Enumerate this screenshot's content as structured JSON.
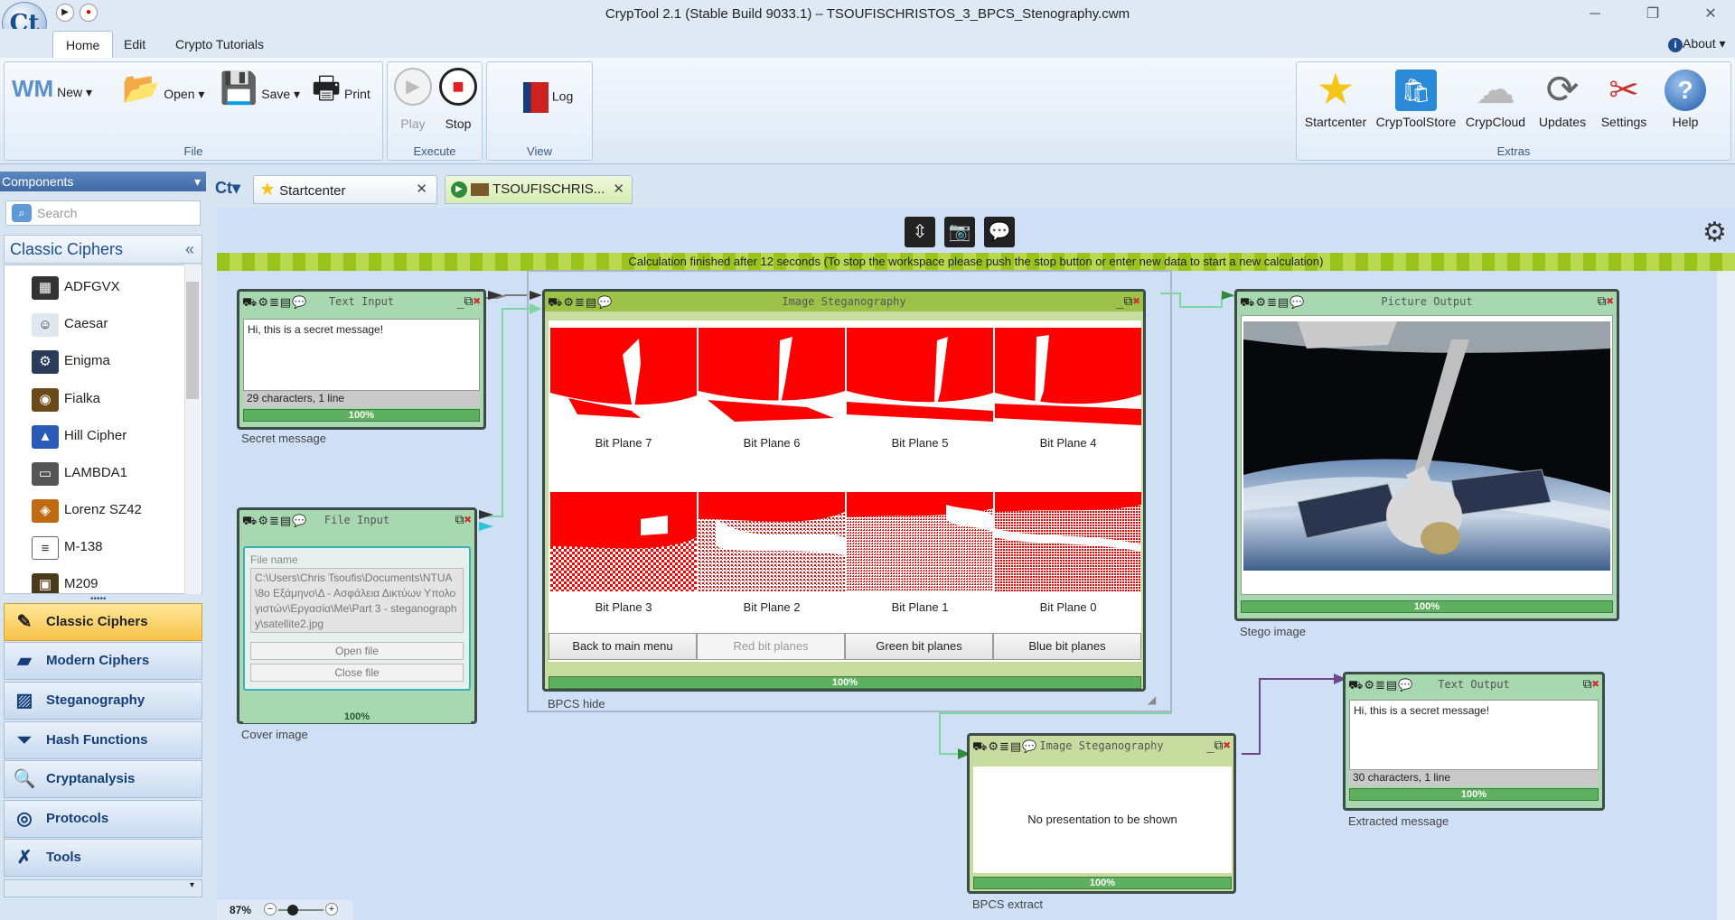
{
  "window": {
    "title": "CrypTool 2.1 (Stable Build 9033.1) – TSOUFISCHRISTOS_3_BPCS_Stenography.cwm"
  },
  "ribbon_tabs": [
    "Home",
    "Edit",
    "Crypto Tutorials"
  ],
  "about_label": "About",
  "ribbon": {
    "file": {
      "label": "File",
      "new": "New",
      "open": "Open",
      "save": "Save",
      "print": "Print"
    },
    "execute": {
      "label": "Execute",
      "play": "Play",
      "stop": "Stop"
    },
    "view": {
      "label": "View",
      "log": "Log"
    },
    "extras": {
      "label": "Extras",
      "items": [
        "Startcenter",
        "CrypToolStore",
        "CrypCloud",
        "Updates",
        "Settings",
        "Help"
      ]
    }
  },
  "components": {
    "header": "Components",
    "search_placeholder": "Search",
    "category_title": "Classic Ciphers",
    "items": [
      "ADFGVX",
      "Caesar",
      "Enigma",
      "Fialka",
      "Hill Cipher",
      "LAMBDA1",
      "Lorenz SZ42",
      "M-138",
      "M209"
    ],
    "categories": [
      "Classic Ciphers",
      "Modern Ciphers",
      "Steganography",
      "Hash Functions",
      "Cryptanalysis",
      "Protocols",
      "Tools"
    ]
  },
  "doc_tabs": [
    "Startcenter",
    "TSOUFISCHRIS..."
  ],
  "status_message": "Calculation finished after 12 seconds (To stop the workspace please push the stop button or enter new data to start a new calculation)",
  "plugins": {
    "text_input": {
      "title": "Text Input",
      "text": "Hi, this is a secret message!",
      "status": "29 characters,  1 line",
      "progress": "100%",
      "caption": "Secret message"
    },
    "file_input": {
      "title": "File Input",
      "file_name_label": "File name",
      "path": "C:\\Users\\Chris Tsoufis\\Documents\\NTUA\\8ο Εξάμηνο\\Δ - Ασφάλεια Δικτύων Υπολογιστών\\Εργασία\\Me\\Part 3 - steganography\\satellite2.jpg",
      "open_btn": "Open file",
      "close_btn": "Close file",
      "progress": "100%",
      "caption": "Cover image"
    },
    "steg_hide": {
      "title": "Image Steganography",
      "bit_planes": [
        "Bit Plane 7",
        "Bit Plane 6",
        "Bit Plane 5",
        "Bit Plane 4",
        "Bit Plane 3",
        "Bit Plane 2",
        "Bit Plane 1",
        "Bit Plane 0"
      ],
      "buttons": [
        "Back to main menu",
        "Red bit planes",
        "Green bit planes",
        "Blue bit planes"
      ],
      "progress": "100%",
      "caption": "BPCS hide"
    },
    "picture_output": {
      "title": "Picture Output",
      "progress": "100%",
      "caption": "Stego image"
    },
    "steg_extract": {
      "title": "Image Steganography",
      "message": "No presentation to be shown",
      "progress": "100%",
      "caption": "BPCS extract"
    },
    "text_output": {
      "title": "Text Output",
      "text": "Hi, this is a secret message!",
      "status": "30 characters,  1 line",
      "progress": "100%",
      "caption": "Extracted message"
    }
  },
  "zoom": "87%",
  "colors": {
    "accent": "#9cc24a",
    "bitplane": "#ff0000",
    "ribbon_blue": "#3f6aa6"
  }
}
